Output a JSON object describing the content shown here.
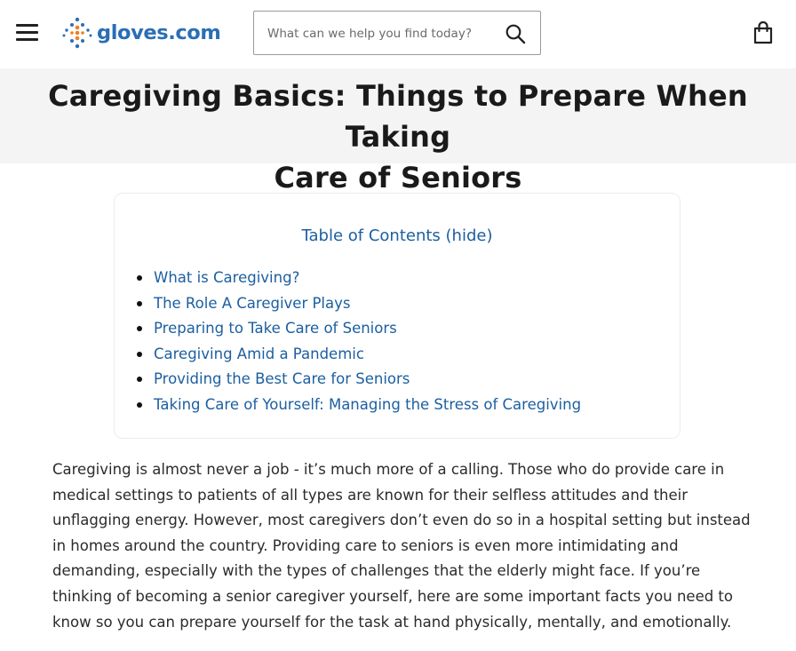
{
  "header": {
    "logo_text": "gloves.com",
    "search": {
      "placeholder": "What can we help you find today?"
    },
    "icons": {
      "menu": "hamburger-menu-icon",
      "search": "search-icon",
      "cart": "shopping-bag-icon"
    }
  },
  "article": {
    "title_line1": "Caregiving Basics: Things to Prepare When Taking",
    "title_line2": "Care of Seniors",
    "toc": {
      "heading": "Table of Contents",
      "toggle": "(hide)",
      "items": [
        "What is Caregiving?",
        "The Role A Caregiver Plays",
        "Preparing to Take Care of Seniors",
        "Caregiving Amid a Pandemic",
        "Providing the Best Care for Seniors",
        "Taking Care of Yourself: Managing the Stress of Caregiving"
      ]
    },
    "intro": "Caregiving is almost never a job - it’s much more of a calling. Those who do provide care in medical settings to patients of all types are known for their selfless attitudes and their unflagging energy. However, most caregivers don’t even do so in a hospital setting but instead in homes around the country. Providing care to seniors is even more intimidating and demanding, especially with the types of challenges that the elderly might face. If you’re thinking of becoming a senior caregiver yourself, here are some important facts you need to know so you can prepare yourself for the task at hand physically, mentally, and emotionally."
  },
  "colors": {
    "link": "#1c5fa0",
    "logo_blue": "#2a6fb5",
    "logo_orange": "#ef7f22",
    "band": "#f4f4f4"
  }
}
